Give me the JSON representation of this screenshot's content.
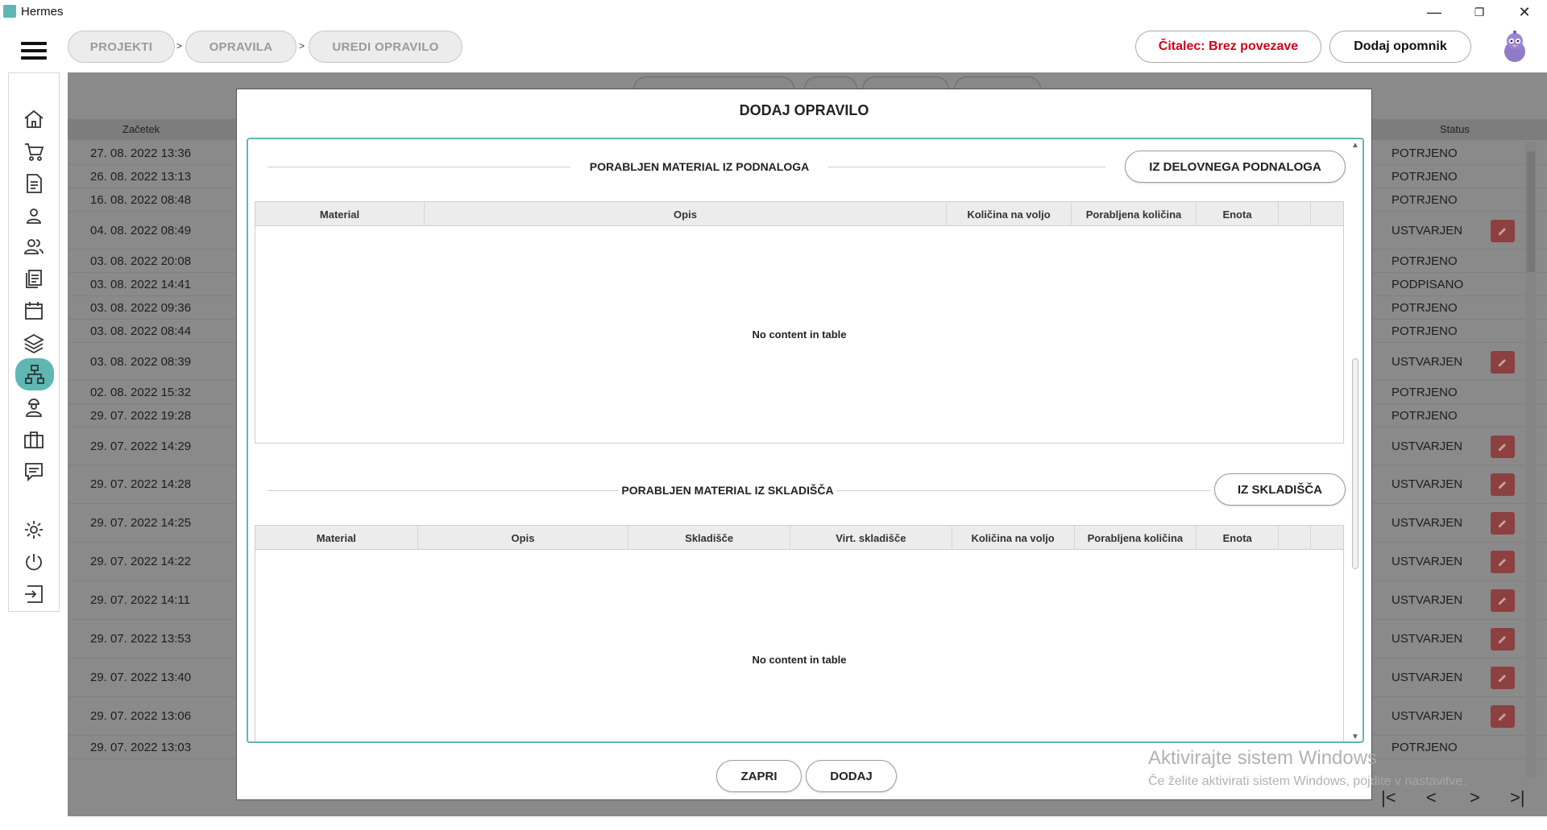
{
  "window": {
    "title": "Hermes",
    "minimize": "—",
    "maximize": "❐",
    "close": "✕"
  },
  "breadcrumb": {
    "items": [
      "PROJEKTI",
      "OPRAVILA",
      "UREDI OPRAVILO"
    ],
    "separator": ">"
  },
  "header": {
    "reader_status": "Čitalec: Brez povezave",
    "add_reminder": "Dodaj opomnik"
  },
  "sidebar": {
    "items": [
      "home",
      "cart",
      "document",
      "user",
      "users",
      "documents",
      "calendar",
      "layers",
      "hierarchy",
      "worker",
      "briefcase",
      "chat",
      "settings",
      "power",
      "logout"
    ],
    "active": "hierarchy"
  },
  "background_table": {
    "col_start": "Začetek",
    "col_status": "Status",
    "rows": [
      {
        "date": "27. 08. 2022 13:36",
        "status": "POTRJENO",
        "editable": false
      },
      {
        "date": "26. 08. 2022 13:13",
        "status": "POTRJENO",
        "editable": false
      },
      {
        "date": "16. 08. 2022 08:48",
        "status": "POTRJENO",
        "editable": false
      },
      {
        "date": "04. 08. 2022 08:49",
        "status": "USTVARJEN",
        "editable": true
      },
      {
        "date": "03. 08. 2022 20:08",
        "status": "POTRJENO",
        "editable": false
      },
      {
        "date": "03. 08. 2022 14:41",
        "status": "PODPISANO",
        "editable": false
      },
      {
        "date": "03. 08. 2022 09:36",
        "status": "POTRJENO",
        "editable": false
      },
      {
        "date": "03. 08. 2022 08:44",
        "status": "POTRJENO",
        "editable": false
      },
      {
        "date": "03. 08. 2022 08:39",
        "status": "USTVARJEN",
        "editable": true
      },
      {
        "date": "02. 08. 2022 15:32",
        "status": "POTRJENO",
        "editable": false
      },
      {
        "date": "29. 07. 2022 19:28",
        "status": "POTRJENO",
        "editable": false
      },
      {
        "date": "29. 07. 2022 14:29",
        "status": "USTVARJEN",
        "editable": true
      },
      {
        "date": "29. 07. 2022 14:28",
        "status": "USTVARJEN",
        "editable": true
      },
      {
        "date": "29. 07. 2022 14:25",
        "status": "USTVARJEN",
        "editable": true
      },
      {
        "date": "29. 07. 2022 14:22",
        "status": "USTVARJEN",
        "editable": true
      },
      {
        "date": "29. 07. 2022 14:11",
        "status": "USTVARJEN",
        "editable": true
      },
      {
        "date": "29. 07. 2022 13:53",
        "status": "USTVARJEN",
        "editable": true
      },
      {
        "date": "29. 07. 2022 13:40",
        "status": "USTVARJEN",
        "editable": true
      },
      {
        "date": "29. 07. 2022 13:06",
        "status": "USTVARJEN",
        "editable": true
      },
      {
        "date": "29. 07. 2022 13:03",
        "status": "POTRJENO",
        "editable": false
      }
    ]
  },
  "modal": {
    "title": "DODAJ OPRAVILO",
    "section1": {
      "title": "PORABLJEN MATERIAL IZ PODNALOGA",
      "button": "IZ DELOVNEGA PODNALOGA",
      "columns": [
        "Material",
        "Opis",
        "Količina na voljo",
        "Porabljena količina",
        "Enota",
        "",
        ""
      ],
      "empty": "No content in table"
    },
    "section2": {
      "title": "PORABLJEN MATERIAL IZ SKLADIŠČA",
      "button": "IZ SKLADIŠČA",
      "columns": [
        "Material",
        "Opis",
        "Skladišče",
        "Virt. skladišče",
        "Količina na voljo",
        "Porabljena količina",
        "Enota",
        "",
        ""
      ],
      "empty": "No content in table"
    },
    "close_button": "ZAPRI",
    "add_button": "DODAJ"
  },
  "watermark": {
    "line1": "Aktivirajte sistem Windows",
    "line2": "Če želite aktivirati sistem Windows, pojdite v nastavitve."
  },
  "pager": {
    "first": "|<",
    "prev": "<",
    "next": ">",
    "last": ">|"
  },
  "colors": {
    "accent": "#5fb7b3",
    "danger": "#d0021b",
    "overlay": "#8a8a8a"
  }
}
